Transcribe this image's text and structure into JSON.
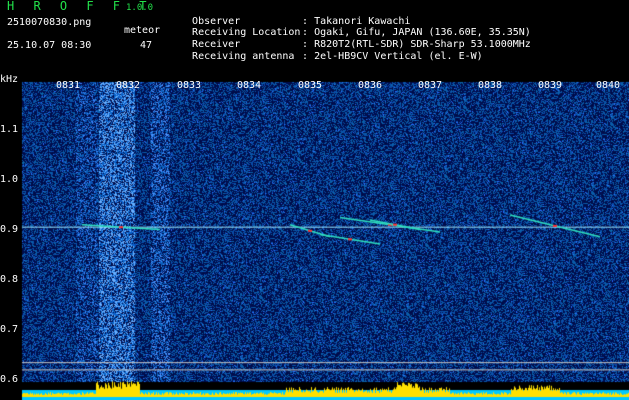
{
  "app": {
    "title": "H R O F F T",
    "version": "1.0.0",
    "filename": "2510070830.png",
    "datetime": "25.10.07 08:30",
    "meteor_label": "meteor",
    "meteor_count": "47"
  },
  "info": [
    {
      "key": "Observer",
      "value": ": Takanori Kawachi"
    },
    {
      "key": "Receiving Location",
      "value": ": Ogaki, Gifu, JAPAN (136.60E, 35.35N)"
    },
    {
      "key": "Receiver",
      "value": ": R820T2(RTL-SDR) SDR-Sharp 53.1000MHz"
    },
    {
      "key": "Receiving antenna",
      "value": ": 2el-HB9CV Vertical (el. E-W)"
    }
  ],
  "chart_data": {
    "type": "heatmap",
    "ylabel": "kHz",
    "y_ticks": [
      "1.1",
      "1.0",
      "0.9",
      "0.8",
      "0.7",
      "0.6"
    ],
    "x_ticks": [
      "0831",
      "0832",
      "0833",
      "0834",
      "0835",
      "0836",
      "0837",
      "0838",
      "0839",
      "0840"
    ],
    "ylim": [
      0.58,
      1.2
    ],
    "colors": {
      "background": "#00003a",
      "noise": "#1840c8",
      "carrier": "#9fe8ff",
      "meteor": "#ff3030",
      "power": "#ffe000",
      "baseline": "#00c8ff"
    }
  }
}
